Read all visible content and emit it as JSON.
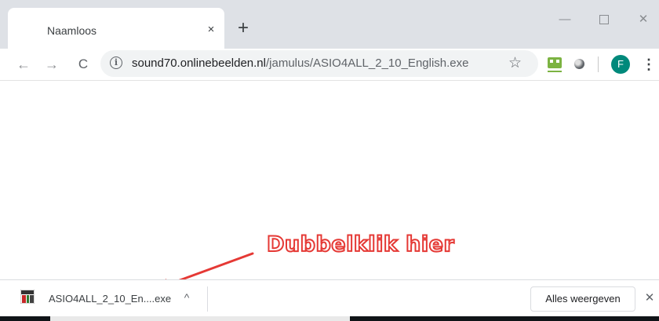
{
  "tab": {
    "title": "Naamloos",
    "close_glyph": "×"
  },
  "new_tab_glyph": "+",
  "window_controls": {
    "minimize": "—",
    "close": "✕"
  },
  "toolbar": {
    "back_glyph": "←",
    "forward_glyph": "→",
    "reload_glyph": "C",
    "url_host": "sound70.onlinebeelden.nl",
    "url_path": "/jamulus/ASIO4ALL_2_10_English.exe",
    "info_glyph": "i",
    "star_glyph": "☆",
    "avatar_letter": "F",
    "menu_glyph": "⋮"
  },
  "annotation": {
    "text": "Dubbelklik hier",
    "color": "#e53935"
  },
  "download_shelf": {
    "file_name": "ASIO4ALL_2_10_En....exe",
    "chevron_glyph": "^",
    "show_all_label": "Alles weergeven",
    "close_glyph": "✕"
  },
  "icons": {
    "info": "info-icon",
    "star": "star-icon",
    "extension": "extension-icon",
    "avatar": "avatar-icon",
    "menu": "menu-icon",
    "file": "asio4all-file-icon"
  },
  "colors": {
    "tabstrip": "#dee1e6",
    "omnibox": "#f1f3f4",
    "avatar": "#00897b",
    "extension": "#7cb342",
    "annotation": "#e53935"
  }
}
